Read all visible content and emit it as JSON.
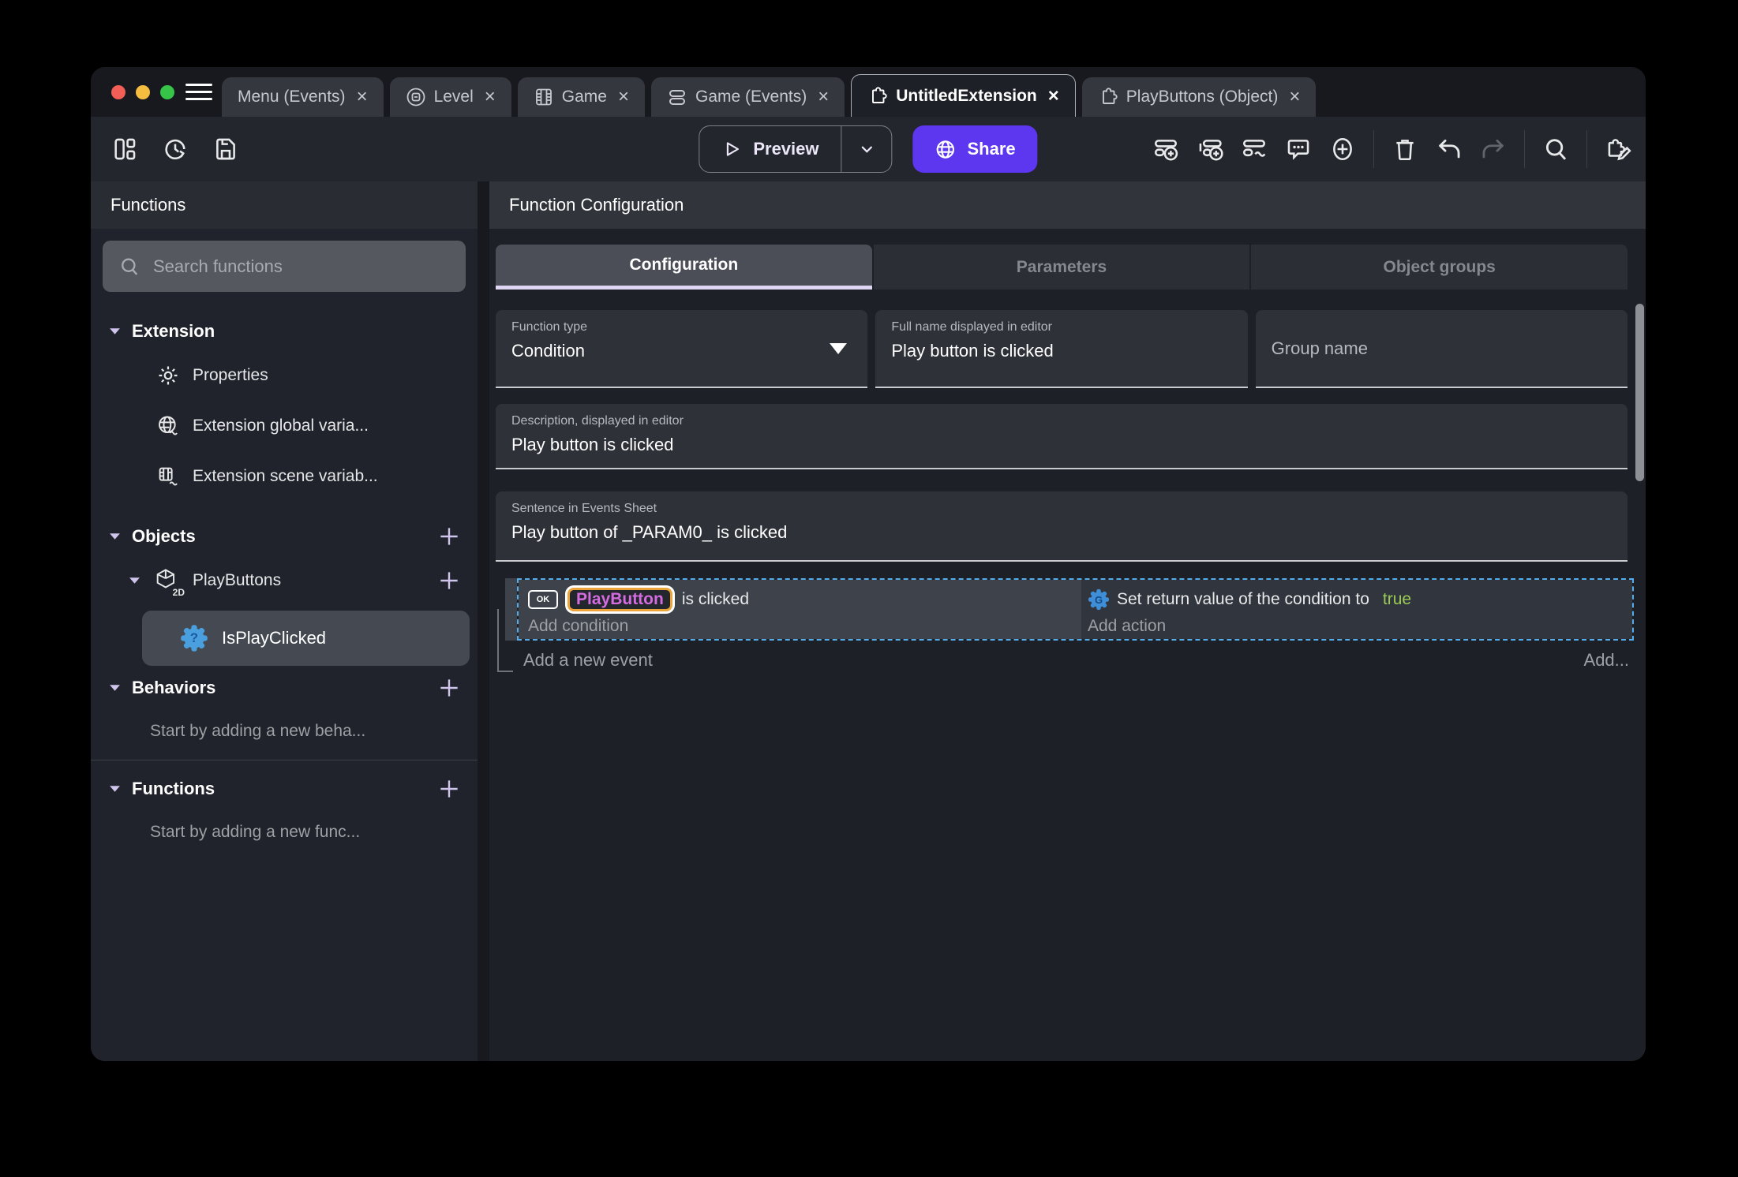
{
  "tab_close_glyph": "×",
  "titlebar": {
    "tabs": [
      {
        "label": "Menu (Events)"
      },
      {
        "label": "Level"
      },
      {
        "label": "Game"
      },
      {
        "label": "Game (Events)"
      },
      {
        "label": "UntitledExtension"
      },
      {
        "label": "PlayButtons (Object)"
      }
    ]
  },
  "toolbar": {
    "preview_label": "Preview",
    "share_label": "Share"
  },
  "sidebar": {
    "title": "Functions",
    "search_placeholder": "Search functions",
    "extension_section": {
      "title": "Extension",
      "items": [
        {
          "label": "Properties"
        },
        {
          "label": "Extension global varia..."
        },
        {
          "label": "Extension scene variab..."
        }
      ]
    },
    "objects_section": {
      "title": "Objects",
      "object_label": "PlayButtons",
      "object_badge": "2D",
      "function_label": "IsPlayClicked",
      "function_icon_glyph": "?"
    },
    "behaviors_section": {
      "title": "Behaviors",
      "empty_text": "Start by adding a new beha..."
    },
    "functions_section": {
      "title": "Functions",
      "empty_text": "Start by adding a new func..."
    }
  },
  "main": {
    "title": "Function Configuration",
    "tabs": [
      {
        "label": "Configuration"
      },
      {
        "label": "Parameters"
      },
      {
        "label": "Object groups"
      }
    ],
    "fields": {
      "function_type": {
        "label": "Function type",
        "value": "Condition"
      },
      "full_name": {
        "label": "Full name displayed in editor",
        "value": "Play button is clicked"
      },
      "group_name": {
        "placeholder": "Group name"
      },
      "description": {
        "label": "Description, displayed in editor",
        "value": "Play button is clicked"
      },
      "sentence": {
        "label": "Sentence in Events Sheet",
        "value": "Play button of _PARAM0_ is clicked"
      }
    },
    "events": {
      "condition_object_icon_text": "OK",
      "condition_object": "PlayButton",
      "condition_text": "is clicked",
      "add_condition": "Add condition",
      "action_icon_glyph": "G",
      "action_text": "Set return value of the condition to",
      "action_value": "true",
      "add_action": "Add action",
      "add_new_event": "Add a new event",
      "add_more": "Add..."
    }
  },
  "colors": {
    "accent_purple": "#5d36f0",
    "selection_blue": "#55ace8",
    "object_purple": "#d46be0",
    "highlight_orange": "#eba33a",
    "true_green": "#9ccb55"
  }
}
